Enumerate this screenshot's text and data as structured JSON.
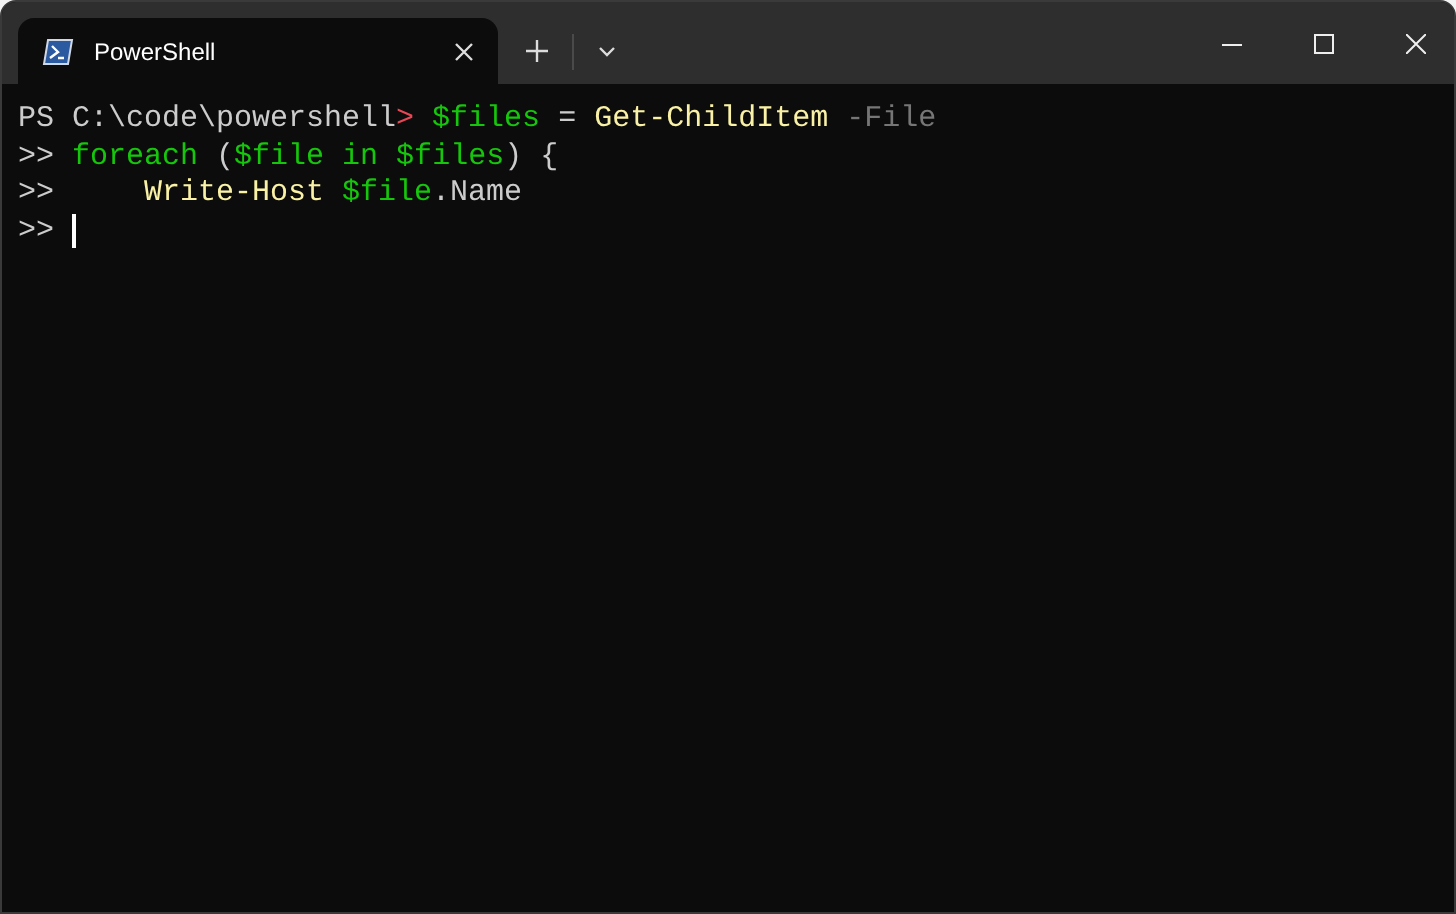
{
  "tab": {
    "title": "PowerShell",
    "selected": true
  },
  "terminal": {
    "lines": [
      {
        "cursor": false,
        "segments": [
          {
            "kind": "plain",
            "text": "PS C:\\code\\powershell"
          },
          {
            "kind": "prompt",
            "text": ">"
          },
          {
            "kind": "variable",
            "text": " $files"
          },
          {
            "kind": "plain",
            "text": " = "
          },
          {
            "kind": "command",
            "text": "Get-ChildItem"
          },
          {
            "kind": "parameter",
            "text": " -File"
          }
        ]
      },
      {
        "cursor": false,
        "segments": [
          {
            "kind": "plain",
            "text": ">> "
          },
          {
            "kind": "keyword",
            "text": "foreach"
          },
          {
            "kind": "plain",
            "text": " ("
          },
          {
            "kind": "variable",
            "text": "$file in $files"
          },
          {
            "kind": "plain",
            "text": ") {"
          }
        ]
      },
      {
        "cursor": false,
        "segments": [
          {
            "kind": "plain",
            "text": ">>     "
          },
          {
            "kind": "command",
            "text": "Write-Host"
          },
          {
            "kind": "variable",
            "text": " $file"
          },
          {
            "kind": "plain",
            "text": ".Name"
          }
        ]
      },
      {
        "cursor": true,
        "segments": [
          {
            "kind": "plain",
            "text": ">> "
          }
        ]
      }
    ]
  }
}
